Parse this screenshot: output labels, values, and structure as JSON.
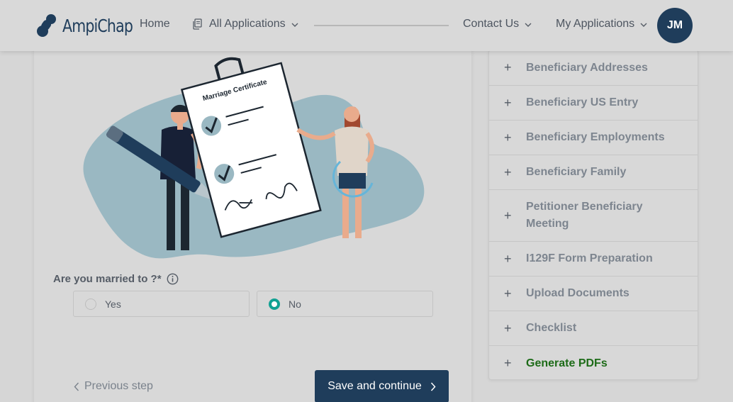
{
  "brand": {
    "name": "AmpiChap"
  },
  "nav": {
    "home": "Home",
    "all_applications": "All Applications",
    "contact_us": "Contact Us",
    "my_applications": "My Applications",
    "avatar_initials": "JM"
  },
  "illustration": {
    "certificate_title": "Marriage Certificate"
  },
  "form": {
    "question": "Are you married to ?*",
    "options": [
      {
        "label": "Yes",
        "checked": false
      },
      {
        "label": "No",
        "checked": true
      }
    ],
    "accent_color": "#11a193"
  },
  "actions": {
    "previous": "Previous step",
    "save": "Save and continue"
  },
  "sidebar": {
    "items": [
      {
        "label": "Beneficiary Addresses"
      },
      {
        "label": "Beneficiary US Entry"
      },
      {
        "label": "Beneficiary Employments"
      },
      {
        "label": "Beneficiary Family"
      },
      {
        "label": "Petitioner Beneficiary Meeting"
      },
      {
        "label": "I129F Form Preparation"
      },
      {
        "label": "Upload Documents"
      },
      {
        "label": "Checklist"
      },
      {
        "label": "Generate PDFs",
        "active": true
      }
    ],
    "plus_symbol": "+"
  },
  "colors": {
    "brand_navy": "#1f3d5b",
    "active_green": "#1d6b18",
    "illustration_blob": "#9ab8c2"
  }
}
